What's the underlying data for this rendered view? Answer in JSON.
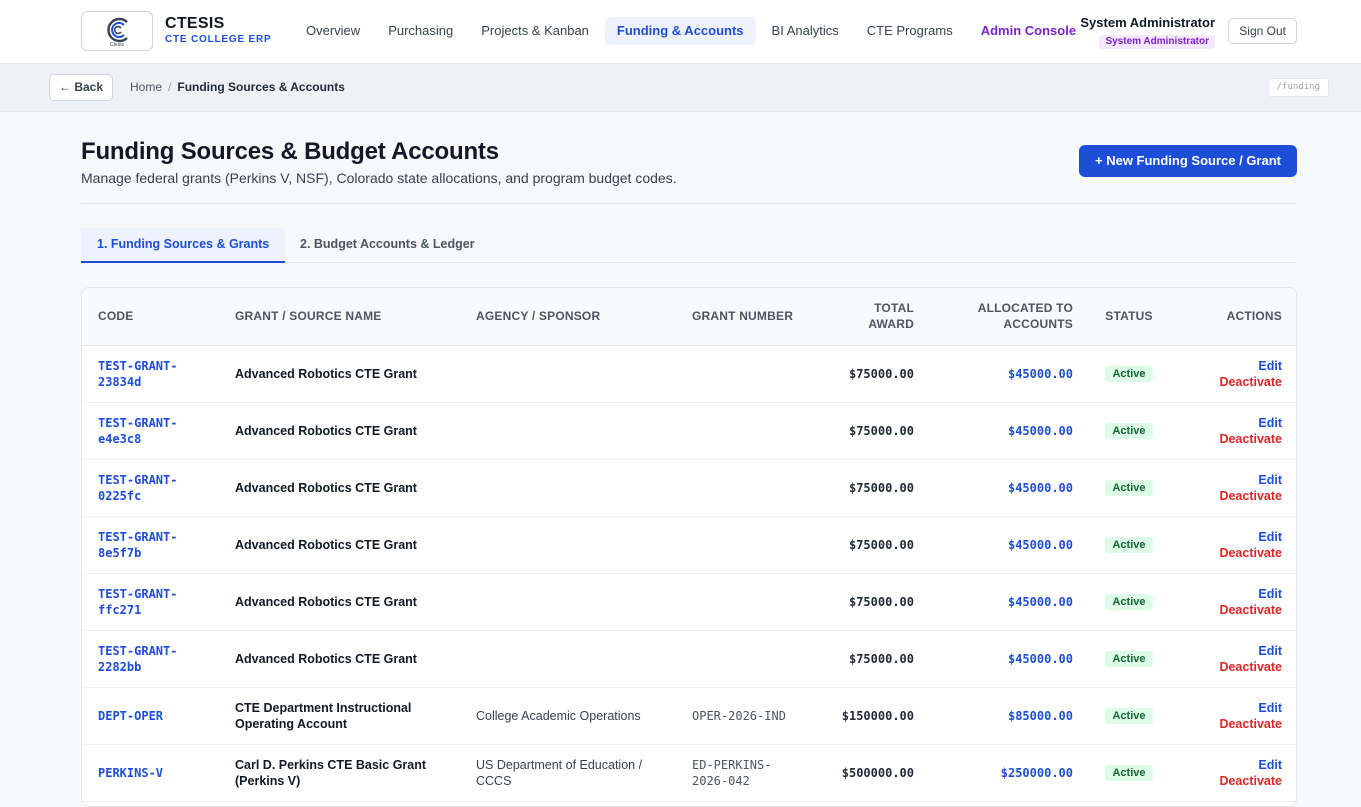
{
  "brand": {
    "logo_caption": "Ctesis",
    "name": "CTESIS",
    "tagline": "CTE COLLEGE ERP"
  },
  "nav": [
    {
      "label": "Overview",
      "active": false
    },
    {
      "label": "Purchasing",
      "active": false
    },
    {
      "label": "Projects & Kanban",
      "active": false
    },
    {
      "label": "Funding & Accounts",
      "active": true
    },
    {
      "label": "BI Analytics",
      "active": false
    },
    {
      "label": "CTE Programs",
      "active": false
    },
    {
      "label": "Admin Console",
      "active": false
    }
  ],
  "user": {
    "name": "System Administrator",
    "role": "System Administrator",
    "signout_label": "Sign Out"
  },
  "breadcrumb": {
    "back_label": "← Back",
    "home": "Home",
    "separator": "/",
    "current": "Funding Sources & Accounts",
    "route": "/funding"
  },
  "page": {
    "title": "Funding Sources & Budget Accounts",
    "subtitle": "Manage federal grants (Perkins V, NSF), Colorado state allocations, and program budget codes.",
    "new_button": "+ New Funding Source / Grant"
  },
  "tabs": [
    {
      "label": "1. Funding Sources & Grants",
      "active": true
    },
    {
      "label": "2. Budget Accounts & Ledger",
      "active": false
    }
  ],
  "table": {
    "columns": [
      "CODE",
      "GRANT / SOURCE NAME",
      "AGENCY / SPONSOR",
      "GRANT NUMBER",
      "TOTAL AWARD",
      "ALLOCATED TO ACCOUNTS",
      "STATUS",
      "ACTIONS"
    ],
    "edit_label": "Edit",
    "deactivate_label": "Deactivate",
    "rows": [
      {
        "code": "TEST-GRANT-23834d",
        "name": "Advanced Robotics CTE Grant",
        "agency": "",
        "grant_number": "",
        "total": "$75000.00",
        "allocated": "$45000.00",
        "status": "Active"
      },
      {
        "code": "TEST-GRANT-e4e3c8",
        "name": "Advanced Robotics CTE Grant",
        "agency": "",
        "grant_number": "",
        "total": "$75000.00",
        "allocated": "$45000.00",
        "status": "Active"
      },
      {
        "code": "TEST-GRANT-0225fc",
        "name": "Advanced Robotics CTE Grant",
        "agency": "",
        "grant_number": "",
        "total": "$75000.00",
        "allocated": "$45000.00",
        "status": "Active"
      },
      {
        "code": "TEST-GRANT-8e5f7b",
        "name": "Advanced Robotics CTE Grant",
        "agency": "",
        "grant_number": "",
        "total": "$75000.00",
        "allocated": "$45000.00",
        "status": "Active"
      },
      {
        "code": "TEST-GRANT-ffc271",
        "name": "Advanced Robotics CTE Grant",
        "agency": "",
        "grant_number": "",
        "total": "$75000.00",
        "allocated": "$45000.00",
        "status": "Active"
      },
      {
        "code": "TEST-GRANT-2282bb",
        "name": "Advanced Robotics CTE Grant",
        "agency": "",
        "grant_number": "",
        "total": "$75000.00",
        "allocated": "$45000.00",
        "status": "Active"
      },
      {
        "code": "DEPT-OPER",
        "name": "CTE Department Instructional Operating Account",
        "agency": "College Academic Operations",
        "grant_number": "OPER-2026-IND",
        "total": "$150000.00",
        "allocated": "$85000.00",
        "status": "Active"
      },
      {
        "code": "PERKINS-V",
        "name": "Carl D. Perkins CTE Basic Grant (Perkins V)",
        "agency": "US Department of Education / CCCS",
        "grant_number": "ED-PERKINS-2026-042",
        "total": "$500000.00",
        "allocated": "$250000.00",
        "status": "Active"
      }
    ]
  },
  "colors": {
    "accent": "#1d4ed8",
    "admin": "#7e22ce",
    "danger": "#dc2626",
    "success": "#166534"
  }
}
